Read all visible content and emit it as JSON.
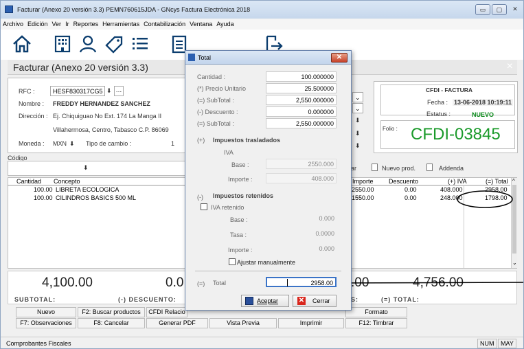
{
  "window": {
    "title": "Facturar (Anexo 20 versión 3.3) PEMN760615JDA - GNcys Factura Electrónica 2018",
    "minimize": "▭",
    "maximize": "▢",
    "close": "✕"
  },
  "menu": [
    "Archivo",
    "Edición",
    "Ver",
    "Ir",
    "Reportes",
    "Herramientas",
    "Contabilización",
    "Ventana",
    "Ayuda"
  ],
  "toolbar_icons": [
    "home-icon",
    "building-icon",
    "user-icon",
    "tag-icon",
    "list-icon",
    "document-icon",
    "exit-icon"
  ],
  "header": {
    "title": "Facturar (Anexo 20 versión 3.3)",
    "close": "×"
  },
  "customer": {
    "rfc_label": "RFC :",
    "rfc_value": "HESF830317CG5",
    "nombre_label": "Nombre :",
    "nombre_value": "FREDDY HERNANDEZ SANCHEZ",
    "direccion_label": "Dirección :",
    "direccion_value": "Ej. Chiquiguao No Ext. 174 La Manga II",
    "ciudad_value": "Villahermosa, Centro, Tabasco C.P. 86069",
    "moneda_label": "Moneda :",
    "moneda_value": "MXN",
    "tipo_cambio_label": "Tipo de cambio :",
    "tipo_cambio_value": "1"
  },
  "cfdi": {
    "type": "CFDI - FACTURA",
    "fecha_label": "Fecha :",
    "fecha_value": "13-06-2018 10:19:11",
    "estatus_label": "Estatus :",
    "estatus_value": "NUEVO",
    "folio_label": "Folio :",
    "folio_value": "CFDI-03845"
  },
  "codigo_label": "Código",
  "options": {
    "ar": "ar",
    "nuevo_prod": "Nuevo prod.",
    "addenda": "Addenda"
  },
  "grid": {
    "headers": {
      "cantidad": "Cantidad",
      "concepto": "Concepto",
      "importe": "Importe",
      "descuento": "Descuento",
      "iva": "(+) IVA",
      "total": "(=) Total"
    },
    "rows": [
      {
        "cantidad": "100.00",
        "concepto": "LIBRETA ECOLOGICA",
        "importe": "2550.00",
        "descuento": "0.00",
        "iva": "408.000",
        "total": "2958.00"
      },
      {
        "cantidad": "100.00",
        "concepto": "CILINDROS BASICS 500 ML",
        "importe": "1550.00",
        "descuento": "0.00",
        "iva": "248.000",
        "total": "1798.00"
      }
    ]
  },
  "totals": {
    "subtotal_value": "4,100.00",
    "subtotal_label": "SUBTOTAL:",
    "descuento_value": "0.0",
    "descuento_label": "(-) DESCUENTO:",
    "iva_value": ".00",
    "iva_label": "S:",
    "total_value": "4,756.00",
    "total_label": "(=) TOTAL:"
  },
  "function_buttons": {
    "row1": [
      "Nuevo",
      "F2: Buscar productos",
      "CFDI Relacio",
      "",
      "",
      "",
      "Formato"
    ],
    "row2": [
      "F7: Observaciones",
      "F8: Cancelar",
      "Generar PDF",
      "Vista Previa",
      "Imprimir",
      "F12: Timbrar"
    ]
  },
  "status": {
    "left": "Comprobantes Fiscales",
    "num": "NUM",
    "may": "MAY"
  },
  "dialog": {
    "title": "Total",
    "close": "✕",
    "cantidad_label": "Cantidad :",
    "cantidad_value": "100.000000",
    "precio_label": "(*) Precio Unitario",
    "precio_value": "25.500000",
    "subtotal_label": "(=) SubTotal :",
    "subtotal_value": "2,550.000000",
    "descuento_label": "(-) Descuento :",
    "descuento_value": "0.000000",
    "subtotal2_label": "(=) SubTotal :",
    "subtotal2_value": "2,550.000000",
    "trasladados_sign": "(+)",
    "trasladados_label": "Impuestos trasladados",
    "iva_label": "IVA",
    "base_label": "Base :",
    "base_value": "2550.000",
    "importe_label": "Importe :",
    "importe_value": "408.000",
    "retenidos_sign": "(-)",
    "retenidos_label": "Impuestos retenidos",
    "iva_retenido_label": "IVA retenido",
    "ret_base_label": "Base :",
    "ret_base_value": "0.000",
    "ret_tasa_label": "Tasa :",
    "ret_tasa_value": "0.0000",
    "ret_importe_label": "Importe :",
    "ret_importe_value": "0.000",
    "ajustar_label": "Ajustar manualmente",
    "total_sign": "(=)",
    "total_label": "Total",
    "total_value": "2958.00",
    "aceptar_label": "Aceptar",
    "cerrar_label": "Cerrar"
  },
  "colors": {
    "folio": "#1a9a2a",
    "estatus": "#0a8a1a",
    "annotation": "#000000"
  }
}
